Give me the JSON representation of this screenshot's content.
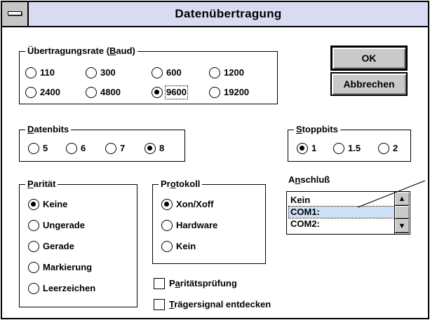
{
  "window": {
    "title": "Datenübertragung"
  },
  "baud": {
    "label_pre": "Übertragungsrate (",
    "label_mn": "B",
    "label_post": "aud)",
    "options": [
      "110",
      "300",
      "600",
      "1200",
      "2400",
      "4800",
      "9600",
      "19200"
    ],
    "selected": "9600"
  },
  "buttons": {
    "ok": "OK",
    "cancel": "Abbrechen"
  },
  "databits": {
    "label_mn": "D",
    "label_rest": "atenbits",
    "options": [
      "5",
      "6",
      "7",
      "8"
    ],
    "selected": "8"
  },
  "stopbits": {
    "label_mn": "S",
    "label_rest": "toppbits",
    "options": [
      "1",
      "1.5",
      "2"
    ],
    "selected": "1"
  },
  "parity": {
    "label_mn": "P",
    "label_rest": "arität",
    "options": [
      "Keine",
      "Ungerade",
      "Gerade",
      "Markierung",
      "Leerzeichen"
    ],
    "selected": "Keine"
  },
  "protocol": {
    "label_pre": "Pr",
    "label_mn": "o",
    "label_post": "tokoll",
    "options": [
      "Xon/Xoff",
      "Hardware",
      "Kein"
    ],
    "selected": "Xon/Xoff"
  },
  "port": {
    "label_pre": "A",
    "label_mn": "n",
    "label_post": "schluß",
    "items": [
      "Kein",
      "COM1:",
      "COM2:"
    ],
    "selected": "COM1:"
  },
  "checks": {
    "parity_check_pre": "P",
    "parity_check_mn": "a",
    "parity_check_post": "ritätsprüfung",
    "carrier_mn": "T",
    "carrier_rest": "rägersignal entdecken"
  },
  "scroll": {
    "up": "▲",
    "down": "▼"
  }
}
